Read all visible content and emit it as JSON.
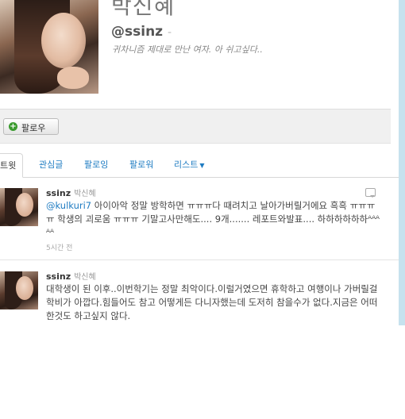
{
  "profile": {
    "name": "박신혜",
    "screen_name": "@ssinz",
    "screen_name_suffix": "-",
    "bio": "귀차니즘 제대로 만난 여자. 아 쉬고싶다.."
  },
  "actions": {
    "follow_label": "팔로우"
  },
  "tabs": [
    {
      "label": "트윗"
    },
    {
      "label": "관심글"
    },
    {
      "label": "팔로잉"
    },
    {
      "label": "팔로워"
    },
    {
      "label": "리스트"
    }
  ],
  "tweets": [
    {
      "user": "ssinz",
      "fullname": "박신혜",
      "mention": "@kulkuri7",
      "text": " 아이아악 정말 방학하면 ㅠㅠㅠ다 때려치고 날아가버릴거에요 흑흑 ㅠㅠㅠㅠ 학생의 괴로움 ㅠㅠㅠ 기말고사만해도.... 9개....... 레포트와발표.... 하하하하하하ᴬᴬᴬᴬᴬ",
      "time": "5시간 전"
    },
    {
      "user": "ssinz",
      "fullname": "박신혜",
      "text": "대학생이 된 이후..이번학기는 정말 최악이다.이럴거였으면 휴학하고 여행이나 가버릴걸 학비가 아깝다.힘들어도 참고 어떻게든 다니자했는데 도저히 참을수가 없다.지금은 어떠한것도 하고싶지 않다."
    }
  ]
}
